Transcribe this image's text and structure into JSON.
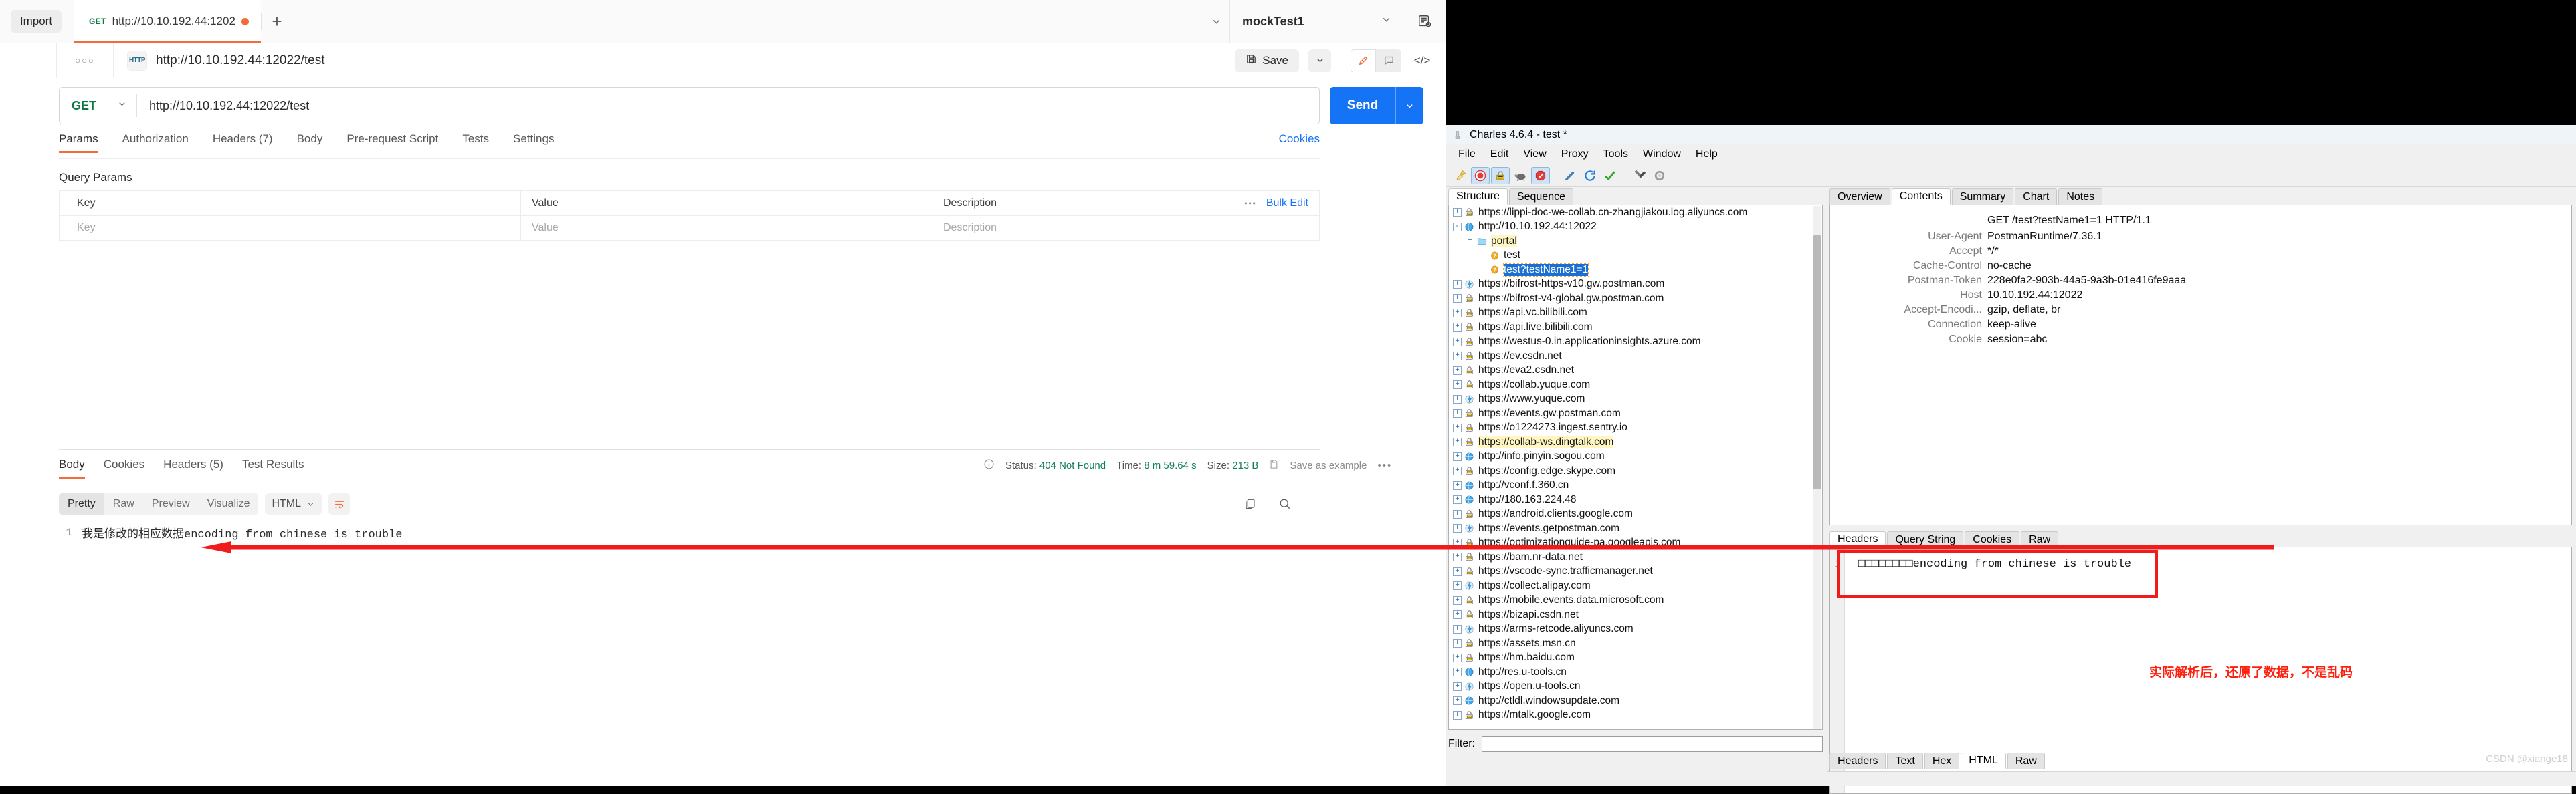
{
  "postman": {
    "import_label": "Import",
    "tab": {
      "method": "GET",
      "title": "http://10.10.192.44:1202",
      "unsaved": true
    },
    "new_tab_label": "+",
    "environment": {
      "name": "mockTest1"
    },
    "request_name": "http://10.10.192.44:12022/test",
    "http_icon_label": "HTTP",
    "save_label": "Save",
    "url_bar": {
      "method": "GET",
      "url": "http://10.10.192.44:12022/test"
    },
    "send_label": "Send",
    "request_tabs": [
      {
        "label": "Params",
        "active": true
      },
      {
        "label": "Authorization",
        "active": false
      },
      {
        "label": "Headers (7)",
        "active": false
      },
      {
        "label": "Body",
        "active": false
      },
      {
        "label": "Pre-request Script",
        "active": false
      },
      {
        "label": "Tests",
        "active": false
      },
      {
        "label": "Settings",
        "active": false
      }
    ],
    "cookies_link": "Cookies",
    "query_params_title": "Query Params",
    "params_table": {
      "headers": [
        "Key",
        "Value",
        "Description"
      ],
      "bulk_edit_label": "Bulk Edit",
      "rows": [
        {
          "key": "Key",
          "value": "Value",
          "description": "Description"
        }
      ]
    },
    "response_tabs": [
      {
        "label": "Body",
        "active": true
      },
      {
        "label": "Cookies",
        "active": false
      },
      {
        "label": "Headers (5)",
        "active": false
      },
      {
        "label": "Test Results",
        "active": false
      }
    ],
    "response_meta": {
      "status_label": "Status:",
      "status_value": "404 Not Found",
      "time_label": "Time:",
      "time_value": "8 m 59.64 s",
      "size_label": "Size:",
      "size_value": "213 B",
      "save_example_label": "Save as example"
    },
    "view_modes": [
      {
        "label": "Pretty",
        "active": true
      },
      {
        "label": "Raw",
        "active": false
      },
      {
        "label": "Preview",
        "active": false
      },
      {
        "label": "Visualize",
        "active": false
      }
    ],
    "language_select": "HTML",
    "response_body": {
      "line_number": "1",
      "text": "我是修改的相应数据encoding from chinese is trouble"
    }
  },
  "charles": {
    "window_title": "Charles 4.6.4 - test *",
    "menu": [
      "File",
      "Edit",
      "View",
      "Proxy",
      "Tools",
      "Window",
      "Help"
    ],
    "toolbar_icons": [
      "clear-broom-icon",
      "record-icon",
      "ssl-proxying-icon",
      "throttle-turtle-icon",
      "breakpoints-icon",
      "compose-pencil-icon",
      "repeat-icon",
      "validate-check-icon",
      "tools-icon",
      "settings-gear-icon"
    ],
    "left_tabs": [
      {
        "label": "Structure",
        "active": true
      },
      {
        "label": "Sequence",
        "active": false
      }
    ],
    "tree": [
      {
        "label": "https://lippi-doc-we-collab.cn-zhangjiakou.log.aliyuncs.com",
        "icon": "lock-icon",
        "indent": 0,
        "expander": "+",
        "state": "normal"
      },
      {
        "label": "http://10.10.192.44:12022",
        "icon": "globe-icon",
        "indent": 0,
        "expander": "-",
        "state": "normal"
      },
      {
        "label": "portal",
        "icon": "folder-icon",
        "indent": 1,
        "expander": "+",
        "state": "highlight"
      },
      {
        "label": "test",
        "icon": "question-icon",
        "indent": 2,
        "expander": "",
        "state": "normal"
      },
      {
        "label": "test?testName1=1",
        "icon": "question-icon",
        "indent": 2,
        "expander": "",
        "state": "selected"
      },
      {
        "label": "https://bifrost-https-v10.gw.postman.com",
        "icon": "socket-icon",
        "indent": 0,
        "expander": "+",
        "state": "normal"
      },
      {
        "label": "https://bifrost-v4-global.gw.postman.com",
        "icon": "lock-icon",
        "indent": 0,
        "expander": "+",
        "state": "normal"
      },
      {
        "label": "https://api.vc.bilibili.com",
        "icon": "lock-icon",
        "indent": 0,
        "expander": "+",
        "state": "normal"
      },
      {
        "label": "https://api.live.bilibili.com",
        "icon": "lock-icon",
        "indent": 0,
        "expander": "+",
        "state": "normal"
      },
      {
        "label": "https://westus-0.in.applicationinsights.azure.com",
        "icon": "lock-icon",
        "indent": 0,
        "expander": "+",
        "state": "normal"
      },
      {
        "label": "https://ev.csdn.net",
        "icon": "lock-icon",
        "indent": 0,
        "expander": "+",
        "state": "normal"
      },
      {
        "label": "https://eva2.csdn.net",
        "icon": "lock-icon",
        "indent": 0,
        "expander": "+",
        "state": "normal"
      },
      {
        "label": "https://collab.yuque.com",
        "icon": "lock-icon",
        "indent": 0,
        "expander": "+",
        "state": "normal"
      },
      {
        "label": "https://www.yuque.com",
        "icon": "socket-icon",
        "indent": 0,
        "expander": "+",
        "state": "normal"
      },
      {
        "label": "https://events.gw.postman.com",
        "icon": "lock-icon",
        "indent": 0,
        "expander": "+",
        "state": "normal"
      },
      {
        "label": "https://o1224273.ingest.sentry.io",
        "icon": "lock-icon",
        "indent": 0,
        "expander": "+",
        "state": "normal"
      },
      {
        "label": "https://collab-ws.dingtalk.com",
        "icon": "lock-icon",
        "indent": 0,
        "expander": "+",
        "state": "highlight"
      },
      {
        "label": "http://info.pinyin.sogou.com",
        "icon": "globe-icon",
        "indent": 0,
        "expander": "+",
        "state": "normal"
      },
      {
        "label": "https://config.edge.skype.com",
        "icon": "lock-icon",
        "indent": 0,
        "expander": "+",
        "state": "normal"
      },
      {
        "label": "http://vconf.f.360.cn",
        "icon": "globe-icon",
        "indent": 0,
        "expander": "+",
        "state": "normal"
      },
      {
        "label": "http://180.163.224.48",
        "icon": "globe-icon",
        "indent": 0,
        "expander": "+",
        "state": "normal"
      },
      {
        "label": "https://android.clients.google.com",
        "icon": "lock-icon",
        "indent": 0,
        "expander": "+",
        "state": "normal"
      },
      {
        "label": "https://events.getpostman.com",
        "icon": "socket-icon",
        "indent": 0,
        "expander": "+",
        "state": "normal"
      },
      {
        "label": "https://optimizationguide-pa.googleapis.com",
        "icon": "lock-icon",
        "indent": 0,
        "expander": "+",
        "state": "normal"
      },
      {
        "label": "https://bam.nr-data.net",
        "icon": "lock-icon",
        "indent": 0,
        "expander": "+",
        "state": "normal"
      },
      {
        "label": "https://vscode-sync.trafficmanager.net",
        "icon": "lock-icon",
        "indent": 0,
        "expander": "+",
        "state": "normal"
      },
      {
        "label": "https://collect.alipay.com",
        "icon": "socket-icon",
        "indent": 0,
        "expander": "+",
        "state": "normal"
      },
      {
        "label": "https://mobile.events.data.microsoft.com",
        "icon": "lock-icon",
        "indent": 0,
        "expander": "+",
        "state": "normal"
      },
      {
        "label": "https://bizapi.csdn.net",
        "icon": "lock-icon",
        "indent": 0,
        "expander": "+",
        "state": "normal"
      },
      {
        "label": "https://arms-retcode.aliyuncs.com",
        "icon": "socket-icon",
        "indent": 0,
        "expander": "+",
        "state": "normal"
      },
      {
        "label": "https://assets.msn.cn",
        "icon": "lock-icon",
        "indent": 0,
        "expander": "+",
        "state": "normal"
      },
      {
        "label": "https://hm.baidu.com",
        "icon": "lock-icon",
        "indent": 0,
        "expander": "+",
        "state": "normal"
      },
      {
        "label": "http://res.u-tools.cn",
        "icon": "globe-icon",
        "indent": 0,
        "expander": "+",
        "state": "normal"
      },
      {
        "label": "https://open.u-tools.cn",
        "icon": "socket-icon",
        "indent": 0,
        "expander": "+",
        "state": "normal"
      },
      {
        "label": "http://ctldl.windowsupdate.com",
        "icon": "globe-icon",
        "indent": 0,
        "expander": "+",
        "state": "normal"
      },
      {
        "label": "https://mtalk.google.com",
        "icon": "lock-icon",
        "indent": 0,
        "expander": "+",
        "state": "normal"
      }
    ],
    "filter_label": "Filter:",
    "filter_value": "",
    "right_tabs": [
      {
        "label": "Overview",
        "active": false
      },
      {
        "label": "Contents",
        "active": true
      },
      {
        "label": "Summary",
        "active": false
      },
      {
        "label": "Chart",
        "active": false
      },
      {
        "label": "Notes",
        "active": false
      }
    ],
    "request_line": "GET /test?testName1=1 HTTP/1.1",
    "request_headers": [
      {
        "name": "User-Agent",
        "value": "PostmanRuntime/7.36.1"
      },
      {
        "name": "Accept",
        "value": "*/*"
      },
      {
        "name": "Cache-Control",
        "value": "no-cache"
      },
      {
        "name": "Postman-Token",
        "value": "228e0fa2-903b-44a5-9a3b-01e416fe9aaa"
      },
      {
        "name": "Host",
        "value": "10.10.192.44:12022"
      },
      {
        "name": "Accept-Encodi...",
        "value": "gzip, deflate, br"
      },
      {
        "name": "Connection",
        "value": "keep-alive"
      },
      {
        "name": "Cookie",
        "value": "session=abc"
      }
    ],
    "request_sub_tabs": [
      {
        "label": "Headers",
        "active": true
      },
      {
        "label": "Query String",
        "active": false
      },
      {
        "label": "Cookies",
        "active": false
      },
      {
        "label": "Raw",
        "active": false
      }
    ],
    "response_line_number": "1",
    "response_text": "□□□□□□□□encoding from chinese is trouble",
    "annotation_note": "实际解析后，还原了数据，不是乱码",
    "response_sub_tabs": [
      {
        "label": "Headers",
        "active": false
      },
      {
        "label": "Text",
        "active": false
      },
      {
        "label": "Hex",
        "active": false
      },
      {
        "label": "HTML",
        "active": true
      },
      {
        "label": "Raw",
        "active": false
      }
    ],
    "watermark": "CSDN @xiange18"
  },
  "colors": {
    "postman_accent": "#f26b3a",
    "send_blue": "#1574f5",
    "method_green": "#0a7a42",
    "annotation_red": "#ff1f0f",
    "charles_select_blue": "#1a6fd4",
    "highlight_yellow": "#fff6c2"
  }
}
